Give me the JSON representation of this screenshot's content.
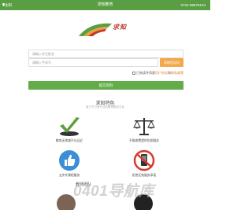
{
  "topbar": {
    "location": "沈阳",
    "title": "求知教育",
    "phone": "0731-88578134"
  },
  "brand": {
    "text": "求知"
  },
  "form": {
    "name_placeholder": "请输入学生姓名",
    "phone_placeholder": "请输入手机号",
    "code_button": "获取验证码",
    "agree_prefix": "已阅读并同意",
    "agree_link1": "用户协议",
    "agree_and": "和",
    "agree_link2": "隐私政策",
    "submit": "提交资料"
  },
  "features": {
    "title": "求知特色",
    "subtitle": "致力于打造专业的教育服务平台",
    "items": [
      {
        "label": "教育无地域不分远近",
        "icon": "checkmark-icon"
      },
      {
        "label": "不限收费提供优质服务",
        "icon": "balance-scale-icon"
      },
      {
        "label": "五步式课程服务",
        "icon": "thumbs-up-icon"
      },
      {
        "label": "拒绝无效服务承诺",
        "icon": "no-phone-icon"
      }
    ],
    "bottom_title": "教师团队"
  },
  "watermark": "0401导航库",
  "colors": {
    "brand_green": "#62ad4a",
    "accent_orange": "#f1a84a",
    "brand_red": "#c0392b"
  }
}
